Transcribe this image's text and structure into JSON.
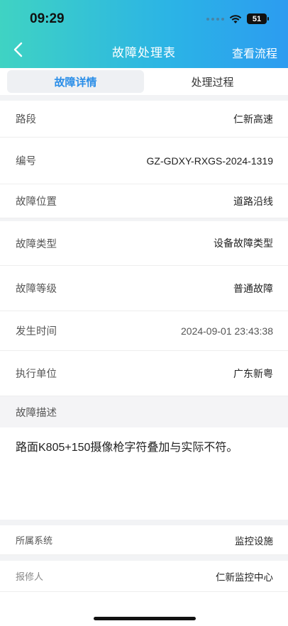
{
  "status_bar": {
    "time": "09:29",
    "battery": "51"
  },
  "header": {
    "title": "故障处理表",
    "flow_link": "查看流程"
  },
  "tabs": [
    {
      "label": "故障详情",
      "active": true
    },
    {
      "label": "处理过程",
      "active": false
    }
  ],
  "fields": {
    "road": {
      "label": "路段",
      "value": "仁新高速"
    },
    "code": {
      "label": "编号",
      "value": "GZ-GDXY-RXGS-2024-1319"
    },
    "location": {
      "label": "故障位置",
      "value": "道路沿线"
    },
    "type": {
      "label": "故障类型",
      "value": "设备故障类型"
    },
    "level": {
      "label": "故障等级",
      "value": "普通故障"
    },
    "time": {
      "label": "发生时间",
      "value": "2024-09-01 23:43:38"
    },
    "unit": {
      "label": "执行单位",
      "value": "广东新粤"
    }
  },
  "description": {
    "label": "故障描述",
    "text": "路面K805+150摄像枪字符叠加与实际不符。"
  },
  "system": {
    "label": "所属系统",
    "value": "监控设施"
  },
  "reporter": {
    "label": "报修人",
    "value": "仁新监控中心"
  }
}
